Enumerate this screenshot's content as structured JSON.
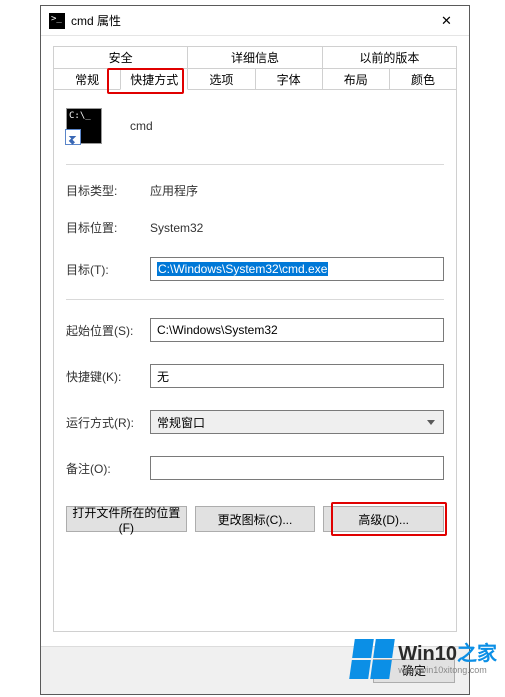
{
  "titlebar": {
    "title": "cmd 属性",
    "close": "✕"
  },
  "tabs": {
    "row1": [
      "安全",
      "详细信息",
      "以前的版本"
    ],
    "row2": [
      "常规",
      "快捷方式",
      "选项",
      "字体",
      "布局",
      "颜色"
    ],
    "active": "快捷方式"
  },
  "main": {
    "app_name": "cmd",
    "target_type_label": "目标类型:",
    "target_type_value": "应用程序",
    "target_loc_label": "目标位置:",
    "target_loc_value": "System32",
    "target_label": "目标(T):",
    "target_value": "C:\\Windows\\System32\\cmd.exe",
    "startin_label": "起始位置(S):",
    "startin_value": "C:\\Windows\\System32",
    "hotkey_label": "快捷键(K):",
    "hotkey_value": "无",
    "runas_label": "运行方式(R):",
    "runas_value": "常规窗口",
    "comment_label": "备注(O):",
    "comment_value": ""
  },
  "buttons": {
    "open_loc": "打开文件所在的位置(F)",
    "change_icon": "更改图标(C)...",
    "advanced": "高级(D)..."
  },
  "dialog_buttons": {
    "ok": "确定"
  },
  "watermark": {
    "big_a": "Win10",
    "big_b": "之家",
    "small": "www.win10xitong.com"
  }
}
